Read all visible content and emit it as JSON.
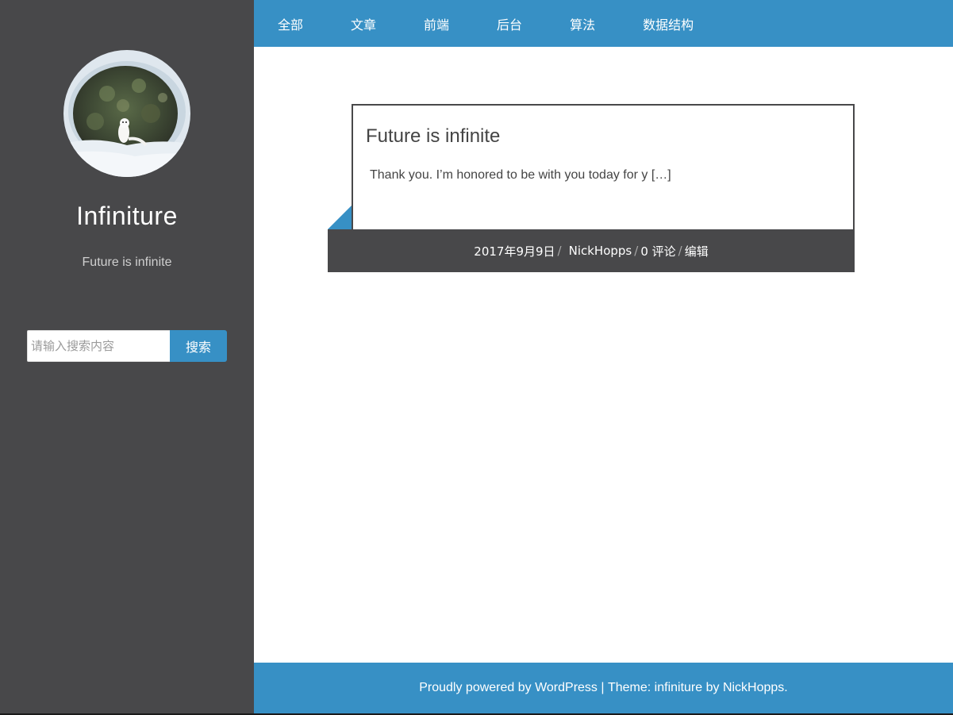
{
  "colors": {
    "sidebar_bg": "#48484a",
    "accent": "#3790c5",
    "text_dark": "#444444",
    "white": "#ffffff"
  },
  "sidebar": {
    "avatar_icon": "avatar-ermine-in-snow",
    "site_title": "Infiniture",
    "site_description": "Future is infinite",
    "search": {
      "placeholder": "请输入搜索内容",
      "value": "",
      "button_label": "搜索"
    }
  },
  "nav": {
    "items": [
      {
        "label": "全部"
      },
      {
        "label": "文章"
      },
      {
        "label": "前端"
      },
      {
        "label": "后台"
      },
      {
        "label": "算法"
      },
      {
        "label": "数据结构"
      }
    ]
  },
  "post": {
    "title": "Future is infinite",
    "excerpt": "Thank you. I’m honored to be with you today for y […]",
    "meta": {
      "date": "2017年9月9日",
      "author": "NickHopps",
      "comments": "0 评论",
      "edit": "编辑",
      "separator": "/"
    }
  },
  "footer": {
    "powered_text": "Proudly powered by WordPress",
    "divider": " | ",
    "theme_prefix": "Theme: infiniture by ",
    "theme_author": "NickHopps",
    "end": "."
  }
}
